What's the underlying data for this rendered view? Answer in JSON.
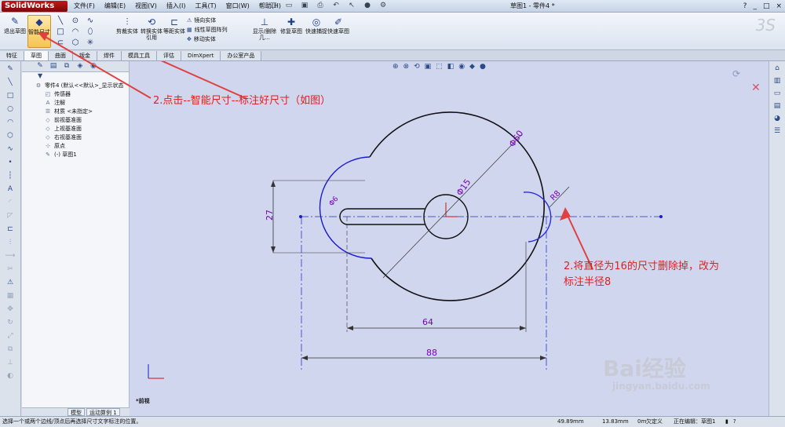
{
  "app": {
    "logo": "SolidWorks",
    "doc_title": "草图1 - 零件4 *"
  },
  "menu": [
    "文件(F)",
    "编辑(E)",
    "视图(V)",
    "插入(I)",
    "工具(T)",
    "窗口(W)",
    "帮助(H)"
  ],
  "quick_icons": [
    "new-icon",
    "open-icon",
    "save-icon",
    "print-icon",
    "undo-icon",
    "select-icon",
    "rebuild-icon",
    "options-icon"
  ],
  "window_controls": [
    "?",
    "_",
    "□",
    "×"
  ],
  "ribbon": {
    "exit_sketch": "退出草图",
    "smart_dimension": "智能尺寸",
    "trim": "剪裁实体",
    "convert": "转换实体引用",
    "offset": "等距实体",
    "mirror": "镜向实体",
    "linear_pattern": "线性草图阵列",
    "move": "移动实体",
    "show_delete": "显示/删除几...",
    "repair": "修复草图",
    "quick_snap": "快速捕捉",
    "rapid_sketch": "快速草图"
  },
  "tabs": [
    "特征",
    "草图",
    "曲面",
    "钣金",
    "焊件",
    "模具工具",
    "评估",
    "DimXpert",
    "办公室产品"
  ],
  "active_tab": "草图",
  "tree": {
    "part": "零件4 (默认<<默认>_显示状态",
    "items": [
      {
        "label": "传感器",
        "icon": "sensor-icon"
      },
      {
        "label": "注解",
        "icon": "annotation-icon"
      },
      {
        "label": "材质 <未指定>",
        "icon": "material-icon"
      },
      {
        "label": "前视基准面",
        "icon": "plane-icon"
      },
      {
        "label": "上视基准面",
        "icon": "plane-icon"
      },
      {
        "label": "右视基准面",
        "icon": "plane-icon"
      },
      {
        "label": "原点",
        "icon": "origin-icon"
      },
      {
        "label": "(-) 草图1",
        "icon": "sketch-icon"
      }
    ]
  },
  "bottom_tabs": [
    "模型",
    "运动算例 1"
  ],
  "drawing": {
    "dims": {
      "d60": "Φ60",
      "d15": "Φ15",
      "r8": "R8",
      "d6": "Φ6",
      "h27": "27",
      "w64": "64",
      "w88": "88"
    },
    "view": "*前视"
  },
  "annotations": {
    "a1": "2.点击--智能尺寸--标注好尺寸（如图）",
    "a2_line1": "2.将直径为16的尺寸删除掉，改为",
    "a2_line2": "标注半径8"
  },
  "status": {
    "message": "选择一个或两个边线/顶点后再选择尺寸文字标注的位置。",
    "x": "49.89mm",
    "y": "13.83mm",
    "z": "0m",
    "defined": "欠定义",
    "editing": "正在编辑：草图1"
  },
  "watermark": {
    "brand": "Bai经验",
    "url": "jingyan.baidu.com"
  },
  "colors": {
    "annotation": "#e02020",
    "sketch_blue": "#1a1ad0",
    "dim_purple": "#7a00b8",
    "background": "#cfd6ee"
  }
}
